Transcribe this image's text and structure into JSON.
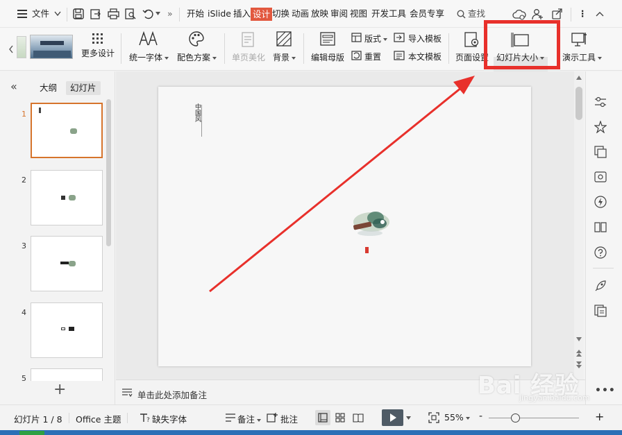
{
  "menubar": {
    "file_label": "文件",
    "tabs": [
      "开始",
      "iSlide",
      "插入",
      "设计",
      "切换",
      "动画",
      "放映",
      "审阅",
      "视图",
      "开发工具",
      "会员专享"
    ],
    "active_tab": "设计",
    "search_label": "查找",
    "more_glyph": "»",
    "overflow_glyph": "⋮"
  },
  "ribbon": {
    "more_design": "更多设计",
    "unify_font": "统一字体",
    "color_scheme": "配色方案",
    "single_beautify": "单页美化",
    "background": "背景",
    "edit_master": "编辑母版",
    "layout": "版式",
    "reset": "重置",
    "import_template": "导入模板",
    "this_template": "本文模板",
    "page_setup": "页面设置",
    "slide_size": "幻灯片大小",
    "presentation_tools": "演示工具"
  },
  "leftpanel": {
    "outline_tab": "大纲",
    "slides_tab": "幻灯片",
    "collapse_glyph": "«",
    "thumbs": [
      {
        "num": "1"
      },
      {
        "num": "2"
      },
      {
        "num": "3"
      },
      {
        "num": "4"
      },
      {
        "num": "5"
      }
    ],
    "add_glyph": "+"
  },
  "slide": {
    "vertical_title": "中国风"
  },
  "notes": {
    "placeholder": "单击此处添加备注"
  },
  "statusbar": {
    "slide_counter": "幻灯片 1 / 8",
    "theme": "Office 主题",
    "missing_fonts": "缺失字体",
    "notes": "备注",
    "comments": "批注",
    "zoom": "55%",
    "minus": "-",
    "plus": "+"
  },
  "watermark": {
    "text": "Bai 经验",
    "sub": "jingyan.baidu.com"
  },
  "colors": {
    "accent": "#e2583e",
    "highlight_box": "#e8302b",
    "arrow": "#e8302b",
    "selected_thumb": "#d6742c"
  }
}
